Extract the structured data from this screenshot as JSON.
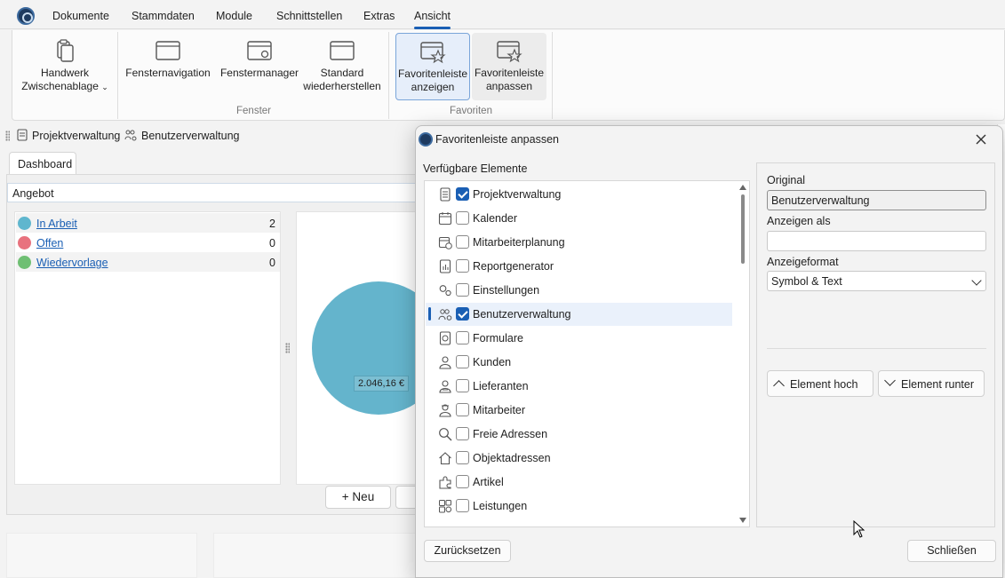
{
  "menu": {
    "items": [
      "Dokumente",
      "Stammdaten",
      "Module",
      "Schnittstellen",
      "Extras",
      "Ansicht"
    ],
    "active": "Ansicht"
  },
  "ribbon": {
    "handwerk_line1": "Handwerk",
    "handwerk_line2": "Zwischenablage",
    "fensternavigation": "Fensternavigation",
    "fenstermanager": "Fenstermanager",
    "standard_line1": "Standard",
    "standard_line2": "wiederherstellen",
    "fav_show_line1": "Favoritenleiste",
    "fav_show_line2": "anzeigen",
    "fav_adjust_line1": "Favoritenleiste",
    "fav_adjust_line2": "anpassen",
    "group_fenster": "Fenster",
    "group_favoriten": "Favoriten"
  },
  "favbar": {
    "items": [
      "Projektverwaltung",
      "Benutzerverwaltung"
    ]
  },
  "dashboard": {
    "tab": "Dashboard",
    "section": "Angebot",
    "statuses": [
      {
        "label": "In Arbeit",
        "count": "2",
        "color": "#5fb6ce"
      },
      {
        "label": "Offen",
        "count": "0",
        "color": "#e8727e"
      },
      {
        "label": "Wiedervorlage",
        "count": "0",
        "color": "#6fbf73"
      }
    ],
    "pie_label": "2.046,16 €",
    "new_button": "+ Neu"
  },
  "chart_data": {
    "type": "pie",
    "categories": [
      "In Arbeit"
    ],
    "values": [
      2046.16
    ],
    "data_labels": [
      "2.046,16 €"
    ],
    "colors": [
      "#64b4cc"
    ]
  },
  "dialog": {
    "title": "Favoritenleiste anpassen",
    "available_label": "Verfügbare Elemente",
    "items": [
      {
        "label": "Projektverwaltung",
        "checked": true,
        "icon": "document-list-icon"
      },
      {
        "label": "Kalender",
        "checked": false,
        "icon": "calendar-icon"
      },
      {
        "label": "Mitarbeiterplanung",
        "checked": false,
        "icon": "calendar-clock-icon"
      },
      {
        "label": "Reportgenerator",
        "checked": false,
        "icon": "report-chart-icon"
      },
      {
        "label": "Einstellungen",
        "checked": false,
        "icon": "gears-icon"
      },
      {
        "label": "Benutzerverwaltung",
        "checked": true,
        "icon": "users-gear-icon",
        "selected": true
      },
      {
        "label": "Formulare",
        "checked": false,
        "icon": "form-icon"
      },
      {
        "label": "Kunden",
        "checked": false,
        "icon": "customer-icon"
      },
      {
        "label": "Lieferanten",
        "checked": false,
        "icon": "supplier-icon"
      },
      {
        "label": "Mitarbeiter",
        "checked": false,
        "icon": "employee-icon"
      },
      {
        "label": "Freie Adressen",
        "checked": false,
        "icon": "search-icon"
      },
      {
        "label": "Objektadressen",
        "checked": false,
        "icon": "home-icon"
      },
      {
        "label": "Artikel",
        "checked": false,
        "icon": "puzzle-icon"
      },
      {
        "label": "Leistungen",
        "checked": false,
        "icon": "services-icon"
      }
    ],
    "original_label": "Original",
    "original_value": "Benutzerverwaltung",
    "display_as_label": "Anzeigen als",
    "display_as_value": "",
    "format_label": "Anzeigeformat",
    "format_value": "Symbol & Text",
    "move_up": "Element hoch",
    "move_down": "Element runter",
    "reset": "Zurücksetzen",
    "close": "Schließen"
  }
}
